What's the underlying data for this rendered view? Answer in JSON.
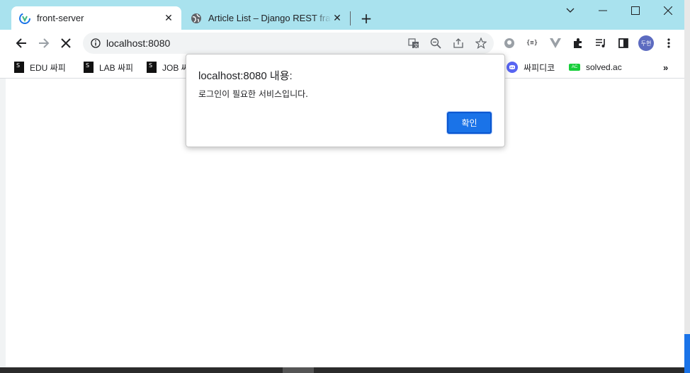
{
  "tabs": [
    {
      "title": "front-server",
      "active": true,
      "favicon": "vue-logo-icon"
    },
    {
      "title": "Article List – Django REST framework",
      "active": false,
      "favicon": "globe-icon"
    }
  ],
  "address_bar": {
    "url": "localhost:8080"
  },
  "bookmarks": [
    {
      "label": "EDU 싸피",
      "icon": "ssafy-icon"
    },
    {
      "label": "LAB 싸피",
      "icon": "ssafy-icon"
    },
    {
      "label": "JOB 싸",
      "icon": "ssafy-icon"
    },
    {
      "label": "싸피디코",
      "icon": "discord-icon"
    },
    {
      "label": "solved.ac",
      "icon": "solvedac-icon"
    }
  ],
  "profile": {
    "initials": "두현"
  },
  "dialog": {
    "title": "localhost:8080 내용:",
    "message": "로그인이 필요한 서비스입니다.",
    "ok_label": "확인"
  },
  "colors": {
    "tabstrip": "#a9e2ee",
    "accent": "#1a73e8"
  }
}
